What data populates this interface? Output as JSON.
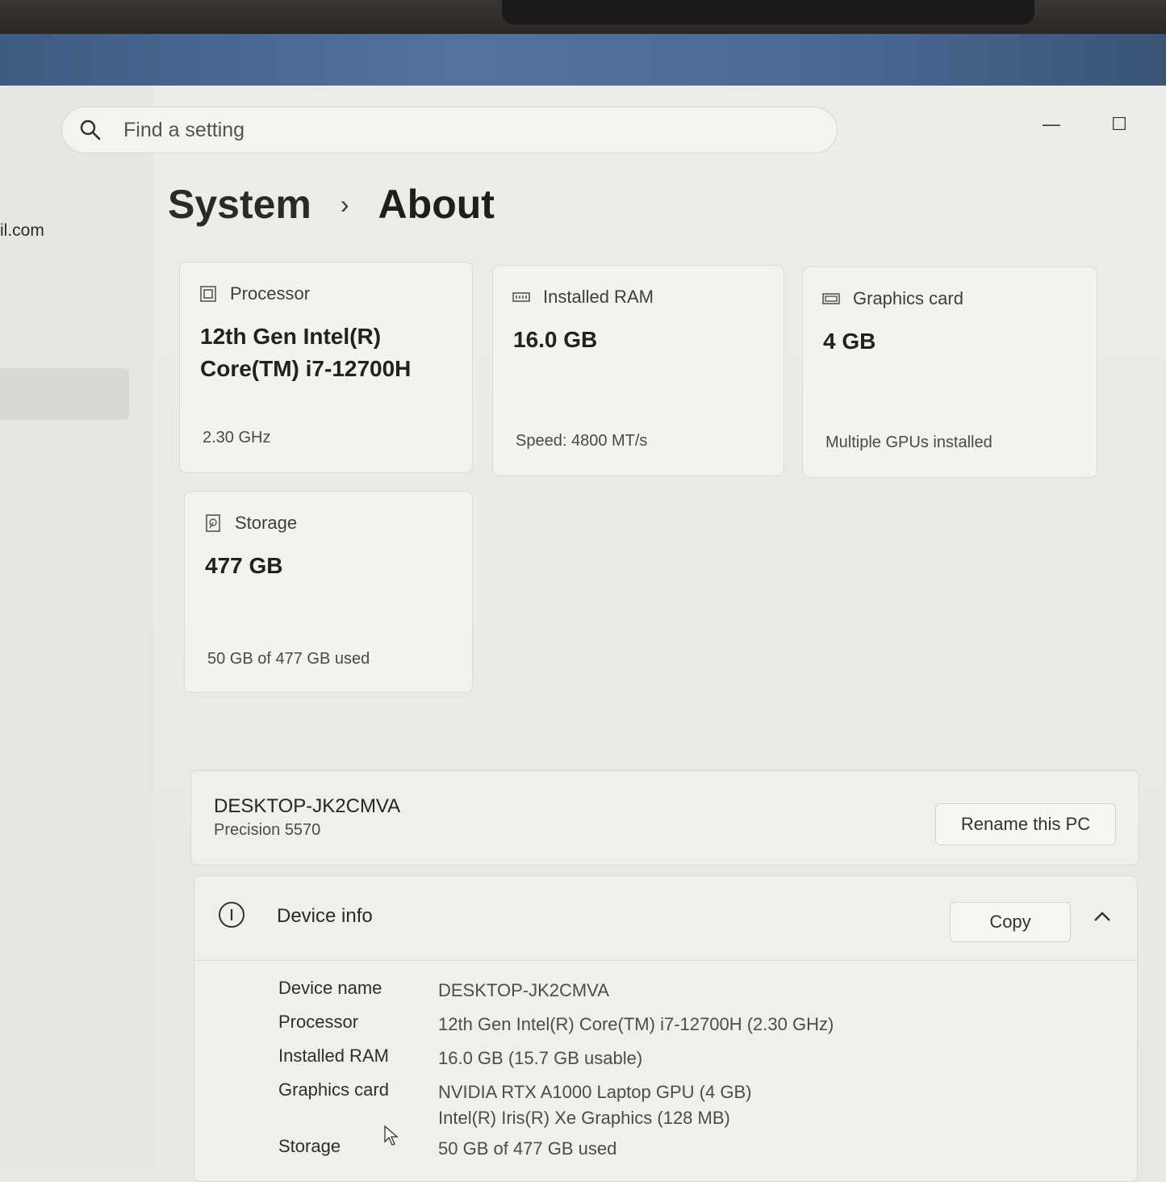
{
  "search": {
    "placeholder": "Find a setting"
  },
  "window_controls": {
    "minimize": "—",
    "maximize": "☐"
  },
  "sidebar": {
    "account_email_fragment": "il.com"
  },
  "breadcrumb": {
    "parent": "System",
    "separator": "›",
    "current": "About"
  },
  "spec_cards": [
    {
      "title": "Processor",
      "value_line1": "12th Gen Intel(R)",
      "value_line2": "Core(TM) i7-12700H",
      "sub": "2.30 GHz",
      "icon": "processor-icon"
    },
    {
      "title": "Installed RAM",
      "value": "16.0 GB",
      "sub": "Speed: 4800 MT/s",
      "icon": "ram-icon"
    },
    {
      "title": "Graphics card",
      "value": "4 GB",
      "sub": "Multiple GPUs installed",
      "icon": "graphics-card-icon"
    },
    {
      "title": "Storage",
      "value": "477 GB",
      "sub": "50 GB of 477 GB used",
      "icon": "storage-icon"
    }
  ],
  "pc": {
    "name": "DESKTOP-JK2CMVA",
    "model": "Precision 5570",
    "rename_label": "Rename this PC"
  },
  "device_info": {
    "title": "Device info",
    "copy_label": "Copy",
    "rows": [
      {
        "label": "Device name",
        "value": "DESKTOP-JK2CMVA"
      },
      {
        "label": "Processor",
        "value": "12th Gen Intel(R) Core(TM) i7-12700H (2.30 GHz)"
      },
      {
        "label": "Installed RAM",
        "value": "16.0 GB (15.7 GB usable)"
      },
      {
        "label": "Graphics card",
        "value": "NVIDIA RTX A1000 Laptop GPU (4 GB)",
        "value2": "Intel(R) Iris(R) Xe Graphics (128 MB)"
      },
      {
        "label": "Storage",
        "value": "50 GB of 477 GB used"
      }
    ]
  }
}
